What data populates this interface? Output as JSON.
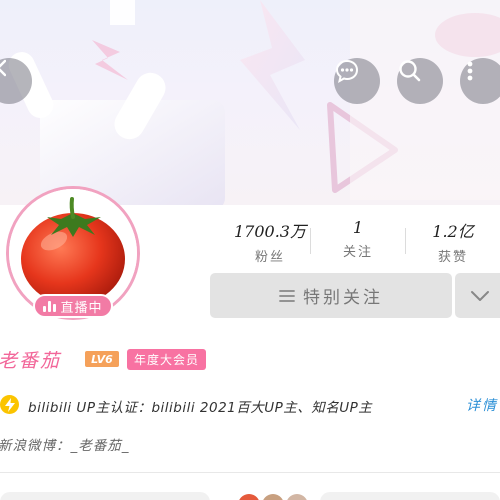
{
  "header": {
    "back_icon": "chevron-left-icon",
    "chat_icon": "chat-bubble-icon",
    "search_icon": "search-icon",
    "more_icon": "more-vertical-icon"
  },
  "profile": {
    "live_badge": "直播中",
    "stats": [
      {
        "value": "1700.3万",
        "label": "粉丝"
      },
      {
        "value": "1",
        "label": "关注"
      },
      {
        "value": "1.2亿",
        "label": "获赞"
      }
    ],
    "follow_label": "特别关注",
    "name": "老番茄",
    "level": "LV6",
    "vip_label": "年度大会员",
    "verify_text": "bilibili UP主认证：bilibili 2021百大UP主、知名UP主",
    "detail_link": "详情",
    "weibo_text": "新浪微博：_老番茄_"
  },
  "colors": {
    "accent_pink": "#f26699",
    "level_orange": "#f5a15a",
    "verify_yellow": "#fbc400",
    "link_blue": "#2b8fd6"
  }
}
